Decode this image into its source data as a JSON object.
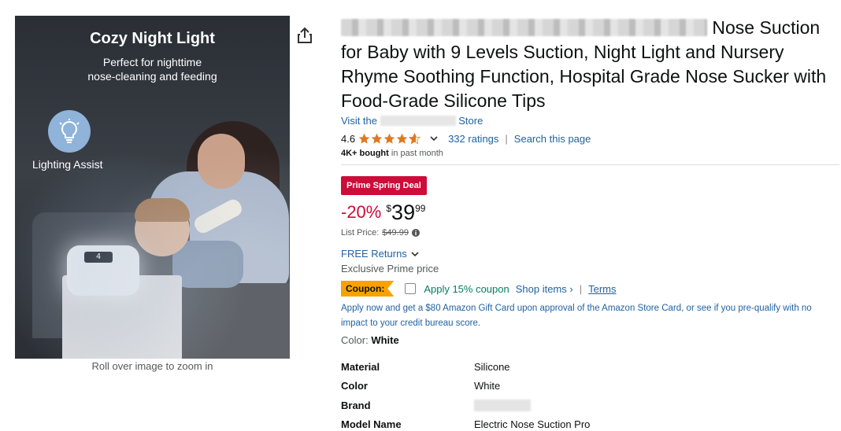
{
  "image": {
    "title": "Cozy Night Light",
    "subtitle_line1": "Perfect for nighttime",
    "subtitle_line2": "nose-cleaning and feeding",
    "badge_label": "Lighting Assist",
    "device_display": "4"
  },
  "zoom_hint": "Roll over image to zoom in",
  "product": {
    "title_tail_line1": "Nose Suction",
    "title_rest": "for Baby with 9 Levels Suction, Night Light and Nursery Rhyme Soothing Function, Hospital Grade Nose Sucker with Food-Grade Silicone Tips",
    "store_prefix": "Visit the",
    "store_suffix": "Store",
    "rating_value": "4.6",
    "rating_stars": 4.6,
    "ratings_count": "332 ratings",
    "search_page": "Search this page",
    "bought_bold": "4K+ bought",
    "bought_rest": "in past month"
  },
  "pricing": {
    "deal_badge": "Prime Spring Deal",
    "discount": "-20%",
    "currency_symbol": "$",
    "price_whole": "39",
    "price_fraction": "99",
    "list_price_label": "List Price:",
    "list_price": "$49.99",
    "returns": "FREE Returns",
    "exclusive": "Exclusive Prime price"
  },
  "coupon": {
    "badge": "Coupon:",
    "text": "Apply 15% coupon",
    "shop_items": "Shop items ›",
    "separator": "|",
    "terms": "Terms"
  },
  "offer": {
    "text": "Apply now and get a $80 Amazon Gift Card upon approval of the Amazon Store Card, or see if you pre-qualify with no impact to your credit bureau score."
  },
  "color": {
    "label": "Color:",
    "value": "White"
  },
  "specs": [
    {
      "key": "Material",
      "value": "Silicone"
    },
    {
      "key": "Color",
      "value": "White"
    },
    {
      "key": "Brand",
      "value": ""
    },
    {
      "key": "Model Name",
      "value": "Electric Nose Suction Pro"
    }
  ],
  "colors": {
    "link": "#2162A1",
    "deal_red": "#CC0C39",
    "star": "#DE7921",
    "coupon_orange": "#F7A200",
    "coupon_green": "#067D62"
  },
  "icons": {
    "share": "share-icon",
    "info": "info-icon",
    "bulb": "lightbulb-icon"
  }
}
